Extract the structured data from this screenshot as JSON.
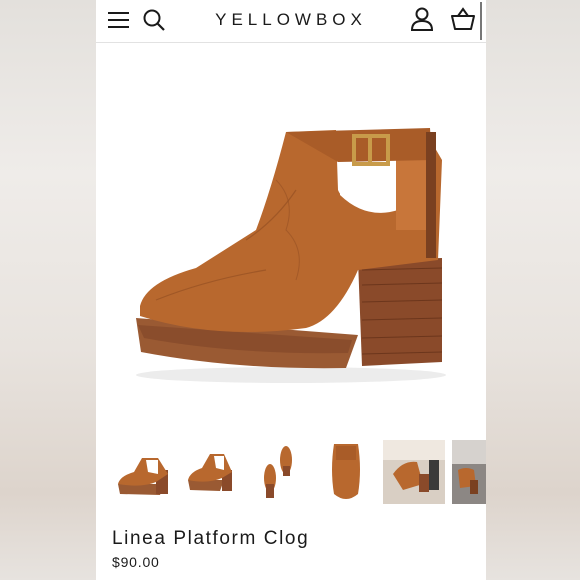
{
  "header": {
    "brand": "YELLOWBOX",
    "icons": [
      "menu-icon",
      "search-icon",
      "account-icon",
      "cart-basket-icon"
    ]
  },
  "product": {
    "name": "Linea Platform Clog",
    "price": "$90.00",
    "colors": {
      "leather": "#b8682e",
      "heel": "#8a4a2a",
      "buckle": "#c89b4a"
    }
  },
  "gallery": {
    "thumbnail_count": 6,
    "selected_index": 0
  }
}
